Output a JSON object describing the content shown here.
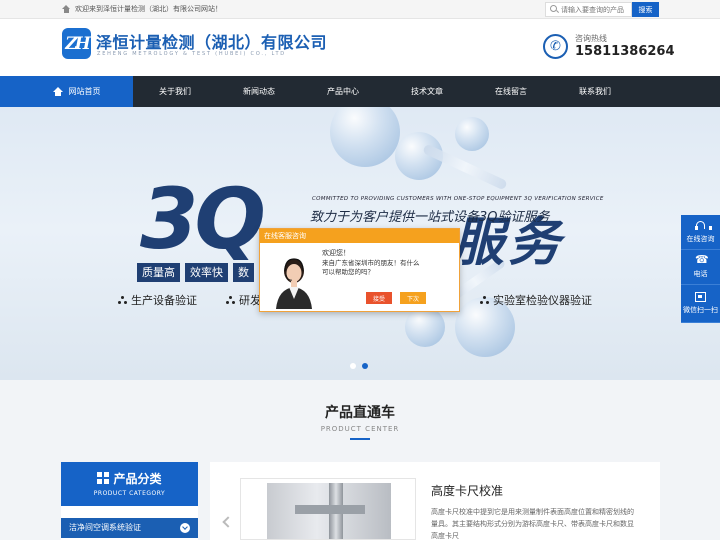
{
  "topbar": {
    "welcome": "欢迎来到泽恒计量检测（湖北）有限公司网站！",
    "search_placeholder": "请输入要查询的产品",
    "search_button": "搜索"
  },
  "header": {
    "logo_mark": "ZH",
    "company_name": "泽恒计量检测（湖北）有限公司",
    "company_en": "ZEHENG METROLOGY & TEST (HUBEI) CO., LTD",
    "hotline_label": "咨询热线",
    "hotline_number": "15811386264"
  },
  "nav": {
    "items": [
      {
        "label": "网站首页"
      },
      {
        "label": "关于我们"
      },
      {
        "label": "新闻动态"
      },
      {
        "label": "产品中心"
      },
      {
        "label": "技术文章"
      },
      {
        "label": "在线留言"
      },
      {
        "label": "联系我们"
      }
    ]
  },
  "banner": {
    "big_text": "3Q",
    "service_text": "服务",
    "slogan_en": "COMMITTED TO PROVIDING CUSTOMERS WITH ONE-STOP EQUIPMENT 3Q VERIFICATION SERVICE",
    "slogan_zh": "致力于为客户提供一站式设备3Q验证服务",
    "tags": [
      "质量高",
      "效率快",
      "数"
    ],
    "bullets": [
      "生产设备验证",
      "研发",
      "实验室检验仪器验证"
    ],
    "active_slide": 2,
    "slide_count": 2
  },
  "chat": {
    "title": "在线客服咨询",
    "greeting": "欢迎您！",
    "line1": "来自广东省深圳市的朋友！有什么",
    "line2": "可以帮助您的吗？",
    "accept": "接受",
    "later": "下次"
  },
  "float": {
    "items": [
      {
        "label": "在线咨询",
        "icon": "headset-icon"
      },
      {
        "label": "电话",
        "icon": "phone-icon"
      },
      {
        "label": "微信扫一扫",
        "icon": "qr-icon"
      }
    ]
  },
  "products": {
    "title": "产品直通车",
    "subtitle": "PRODUCT CENTER",
    "category_title": "产品分类",
    "category_sub": "PRODUCT CATEGORY",
    "category_item": "洁净间空调系统验证",
    "product_name": "高度卡尺校准",
    "product_desc": "高度卡尺校准中提到它是用来测量制件表面高度位置和精密划线的量具。其主要结构形式分别为游标高度卡尺、带表高度卡尺和数显高度卡尺"
  },
  "colors": {
    "brand_blue": "#1663c7",
    "nav_dark": "#222a33",
    "chat_orange": "#f5a11e",
    "chat_accept": "#e9522c"
  }
}
